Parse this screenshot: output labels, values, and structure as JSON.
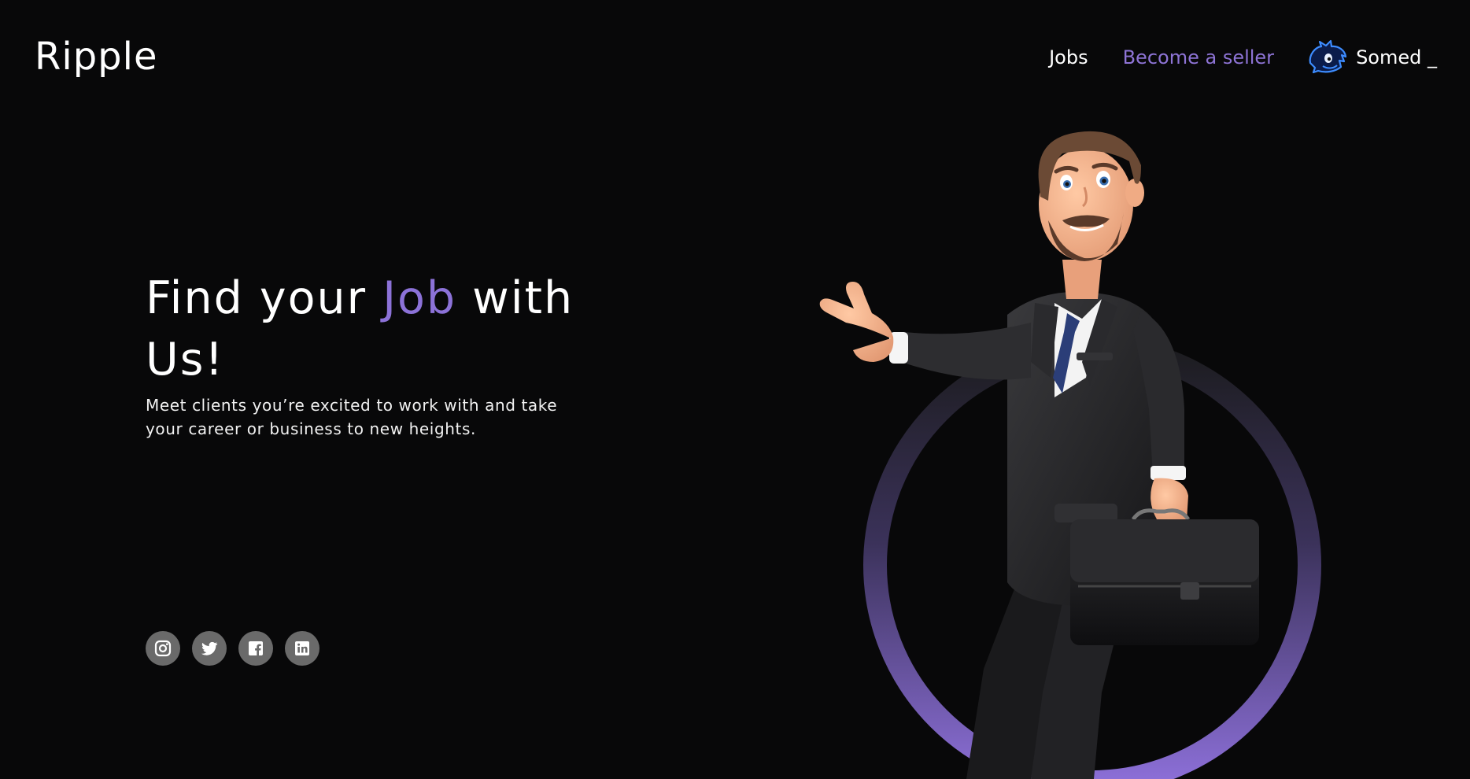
{
  "header": {
    "logo": "Ripple",
    "nav": {
      "jobs": "Jobs",
      "become_seller": "Become a seller",
      "user_name": "Somed _"
    }
  },
  "hero": {
    "title_part1": "Find your ",
    "title_highlight": "Job",
    "title_part2": " with Us!",
    "subtitle": "Meet clients you’re excited to work with and take your career or business to new heights."
  },
  "social": [
    {
      "icon": "instagram-icon"
    },
    {
      "icon": "twitter-icon"
    },
    {
      "icon": "facebook-icon"
    },
    {
      "icon": "linkedin-icon"
    }
  ],
  "illustration": {
    "icon": "businessman-illustration"
  },
  "colors": {
    "background": "#080809",
    "accent": "#8c72d8",
    "text": "#ffffff",
    "social_bg": "#6a6a6a"
  }
}
